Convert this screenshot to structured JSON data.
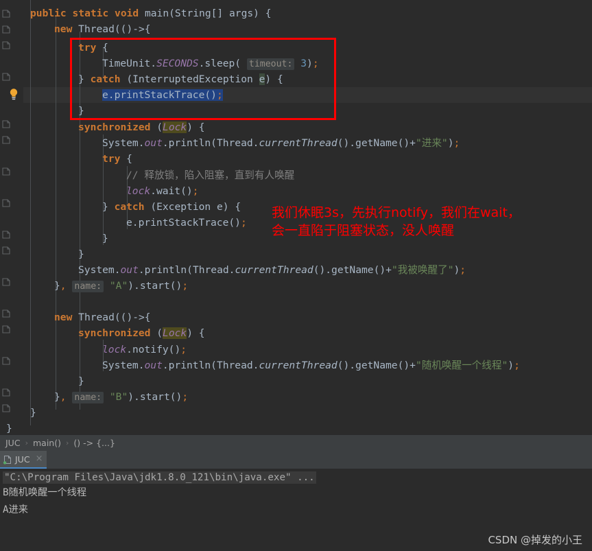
{
  "window": {
    "app": "IntelliJ IDEA",
    "theme_bg": "#2b2b2b",
    "accent": "#4a88c7"
  },
  "editor": {
    "lines": [
      {
        "indent": 0,
        "text": "    public static void main(String[] args) {"
      },
      {
        "indent": 0,
        "text": "        new Thread(()->{"
      },
      {
        "indent": 0,
        "text": "            try {"
      },
      {
        "indent": 0,
        "text": "                TimeUnit.SECONDS.sleep( timeout: 3);"
      },
      {
        "indent": 0,
        "text": "            } catch (InterruptedException e) {"
      },
      {
        "indent": 0,
        "text": "                e.printStackTrace();"
      },
      {
        "indent": 0,
        "text": "            }"
      },
      {
        "indent": 0,
        "text": "            synchronized (Lock) {"
      },
      {
        "indent": 0,
        "text": "                System.out.println(Thread.currentThread().getName()+\"进来\");"
      },
      {
        "indent": 0,
        "text": "                try {"
      },
      {
        "indent": 0,
        "text": "                    // 释放锁，陷入阻塞，直到有人唤醒"
      },
      {
        "indent": 0,
        "text": "                    lock.wait();"
      },
      {
        "indent": 0,
        "text": "                } catch (Exception e) {"
      },
      {
        "indent": 0,
        "text": "                    e.printStackTrace();"
      },
      {
        "indent": 0,
        "text": "                }"
      },
      {
        "indent": 0,
        "text": "            }"
      },
      {
        "indent": 0,
        "text": "            System.out.println(Thread.currentThread().getName()+\"我被唤醒了\");"
      },
      {
        "indent": 0,
        "text": "        }, name: \"A\").start();"
      },
      {
        "indent": 0,
        "text": ""
      },
      {
        "indent": 0,
        "text": "        new Thread(()->{"
      },
      {
        "indent": 0,
        "text": "            synchronized (Lock) {"
      },
      {
        "indent": 0,
        "text": "                lock.notify();"
      },
      {
        "indent": 0,
        "text": "                System.out.println(Thread.currentThread().getName()+\"随机唤醒一个线程\");"
      },
      {
        "indent": 0,
        "text": "            }"
      },
      {
        "indent": 0,
        "text": "        }, name: \"B\").start();"
      },
      {
        "indent": 0,
        "text": "    }"
      },
      {
        "indent": 0,
        "text": "}"
      }
    ],
    "selected_text": "e.printStackTrace();",
    "param_hints": [
      "timeout:",
      "name:",
      "name:"
    ],
    "highlighted_identifier": "Lock",
    "gutter_bulb": "intention-bulb"
  },
  "annotation": {
    "note_line1": "我们休眠3s，先执行notify，我们在wait，",
    "note_line2": "会一直陷于阻塞状态，没人唤醒",
    "box_color": "#ff0000",
    "text_color": "#ff0000"
  },
  "breadcrumb": {
    "items": [
      "JUC",
      "main()",
      "() -> {...}"
    ],
    "separator": "›"
  },
  "tool_window": {
    "tab_label": "JUC",
    "close_label": "×"
  },
  "console": {
    "command": "\"C:\\Program Files\\Java\\jdk1.8.0_121\\bin\\java.exe\" ...",
    "output": [
      "B随机唤醒一个线程",
      "A进来"
    ]
  },
  "watermark": {
    "text": "CSDN @掉发的小王"
  }
}
